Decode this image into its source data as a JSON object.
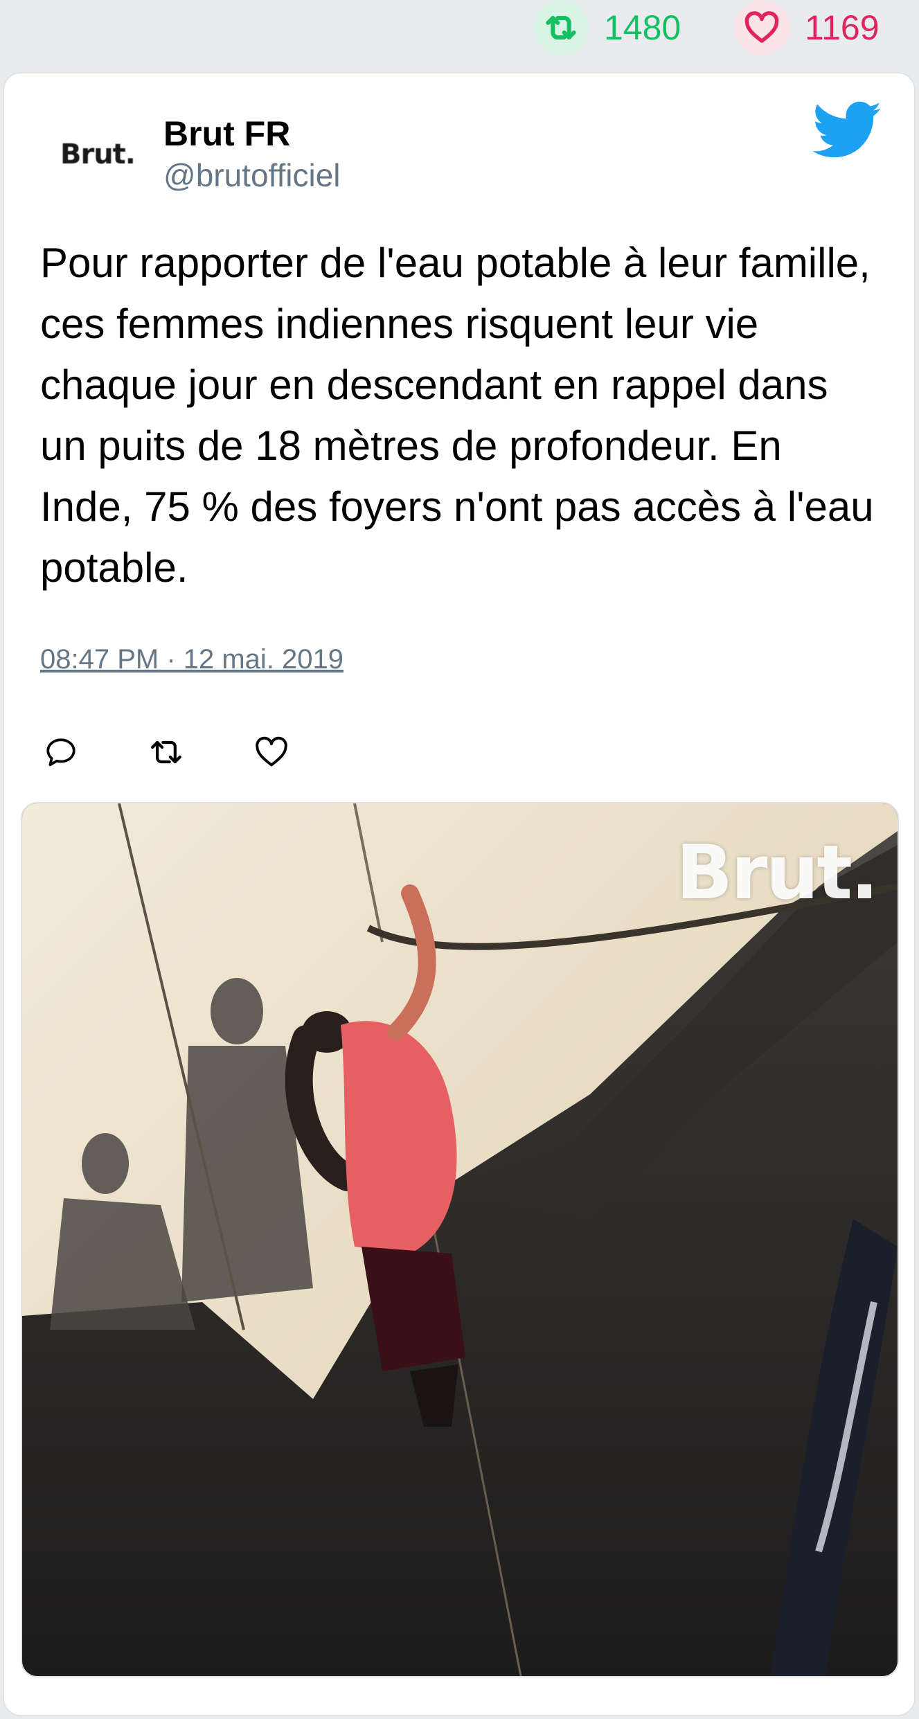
{
  "stats": {
    "retweets": "1480",
    "likes": "1169"
  },
  "colors": {
    "retweet": "#17bf63",
    "like": "#e0245e",
    "twitter_blue": "#1da1f2",
    "handle_gray": "#657786"
  },
  "user": {
    "avatar_text": "Brut.",
    "name": "Brut FR",
    "handle": "@brutofficiel"
  },
  "tweet": {
    "text": "Pour rapporter de l'eau potable à leur famille, ces femmes indiennes risquent leur vie chaque jour en descendant en rappel dans un puits de 18 mètres de profondeur. En Inde, 75 % des foyers n'ont pas accès à l'eau potable.",
    "timestamp": "08:47 PM · 12 mai. 2019"
  },
  "media": {
    "watermark": "Brut."
  },
  "icons": {
    "top_retweet": "retweet-icon",
    "top_like": "heart-icon",
    "brand": "twitter-bird-icon",
    "reply": "reply-icon",
    "retweet": "retweet-icon",
    "like": "heart-icon"
  }
}
